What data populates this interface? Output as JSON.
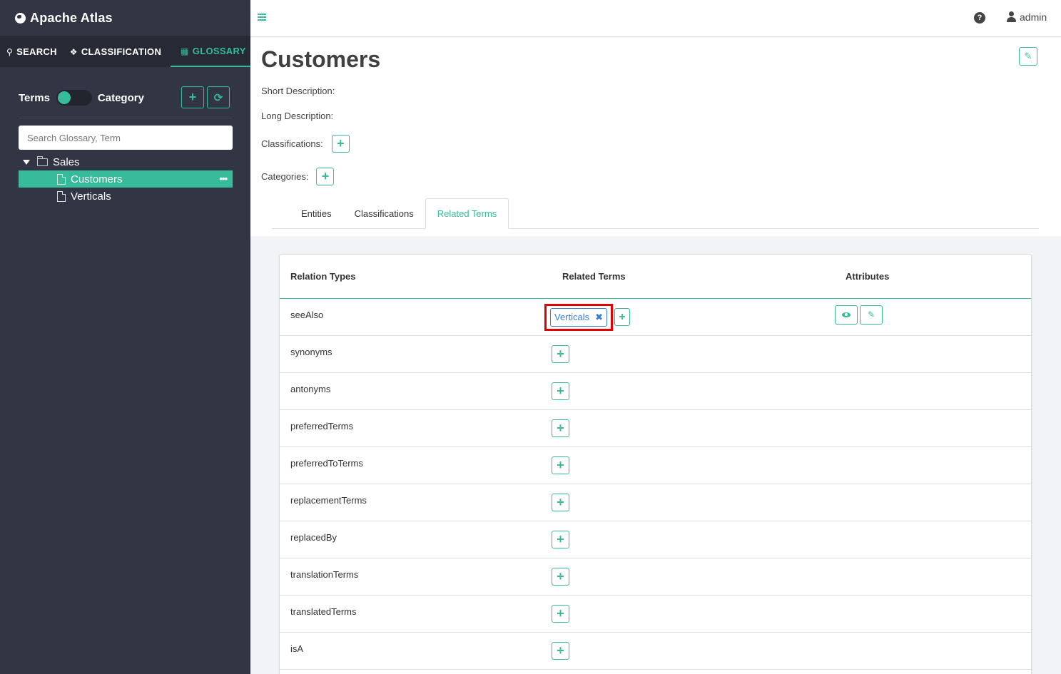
{
  "brand": {
    "name": "Apache Atlas"
  },
  "sidebar": {
    "tabs": [
      {
        "label": "SEARCH",
        "icon": "search-icon"
      },
      {
        "label": "CLASSIFICATION",
        "icon": "tag-icon"
      },
      {
        "label": "GLOSSARY",
        "icon": "folder-open-icon",
        "active": true
      }
    ],
    "toggle": {
      "left_label": "Terms",
      "right_label": "Category"
    },
    "search_placeholder": "Search Glossary, Term",
    "tree": {
      "root": "Sales",
      "items": [
        {
          "label": "Customers",
          "selected": true,
          "more": "•••"
        },
        {
          "label": "Verticals",
          "selected": false
        }
      ]
    },
    "accent_color": "#37bb9b",
    "background_color": "#323544"
  },
  "header": {
    "user": "admin",
    "help_symbol": "?"
  },
  "term": {
    "title": "Customers",
    "short_description_label": "Short Description:",
    "long_description_label": "Long Description:",
    "classifications_label": "Classifications:",
    "categories_label": "Categories:"
  },
  "tabs": [
    {
      "label": "Entities"
    },
    {
      "label": "Classifications"
    },
    {
      "label": "Related Terms",
      "active": true
    }
  ],
  "table": {
    "headers": {
      "relation_types": "Relation Types",
      "related_terms": "Related Terms",
      "attributes": "Attributes"
    },
    "rows": [
      {
        "type": "seeAlso",
        "terms": [
          "Verticals"
        ],
        "remove_symbol": "✖"
      },
      {
        "type": "synonyms"
      },
      {
        "type": "antonyms"
      },
      {
        "type": "preferredTerms"
      },
      {
        "type": "preferredToTerms"
      },
      {
        "type": "replacementTerms"
      },
      {
        "type": "replacedBy"
      },
      {
        "type": "translationTerms"
      },
      {
        "type": "translatedTerms"
      },
      {
        "type": "isA"
      }
    ]
  },
  "icons": {
    "plus": "+",
    "edit": "✎",
    "refresh": "⟳",
    "menu": "hamburger-icon"
  }
}
